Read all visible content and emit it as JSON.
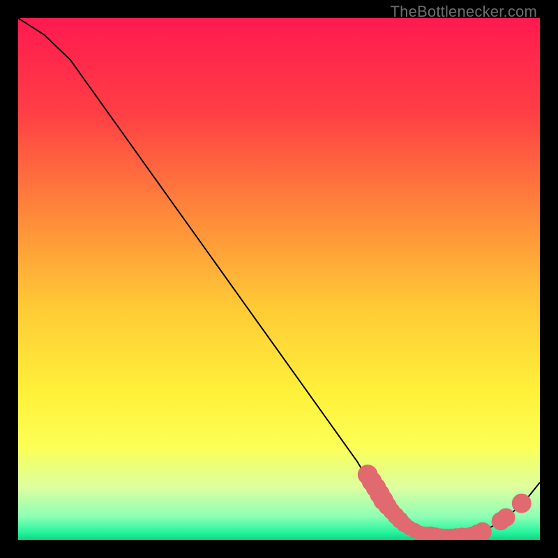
{
  "watermark": "TheBottlenecker.com",
  "chart_data": {
    "type": "line",
    "title": "",
    "xlabel": "",
    "ylabel": "",
    "xlim": [
      0,
      100
    ],
    "ylim": [
      0,
      100
    ],
    "curve": [
      {
        "x": 0.0,
        "y": 100.0
      },
      {
        "x": 5.0,
        "y": 96.8
      },
      {
        "x": 10.0,
        "y": 92.0
      },
      {
        "x": 15.0,
        "y": 85.0
      },
      {
        "x": 20.0,
        "y": 78.0
      },
      {
        "x": 25.0,
        "y": 71.0
      },
      {
        "x": 30.0,
        "y": 64.0
      },
      {
        "x": 35.0,
        "y": 57.0
      },
      {
        "x": 40.0,
        "y": 50.0
      },
      {
        "x": 45.0,
        "y": 43.0
      },
      {
        "x": 50.0,
        "y": 36.0
      },
      {
        "x": 55.0,
        "y": 29.0
      },
      {
        "x": 60.0,
        "y": 22.0
      },
      {
        "x": 65.0,
        "y": 15.0
      },
      {
        "x": 68.0,
        "y": 10.0
      },
      {
        "x": 71.0,
        "y": 6.0
      },
      {
        "x": 74.0,
        "y": 3.0
      },
      {
        "x": 77.0,
        "y": 1.2
      },
      {
        "x": 80.0,
        "y": 0.6
      },
      {
        "x": 83.0,
        "y": 0.5
      },
      {
        "x": 86.0,
        "y": 0.8
      },
      {
        "x": 89.0,
        "y": 1.6
      },
      {
        "x": 92.0,
        "y": 3.2
      },
      {
        "x": 95.0,
        "y": 5.5
      },
      {
        "x": 98.0,
        "y": 8.5
      },
      {
        "x": 100.0,
        "y": 11.0
      }
    ],
    "markers": [
      {
        "x": 67.0,
        "y": 12.5,
        "r": 3.5
      },
      {
        "x": 67.8,
        "y": 11.2,
        "r": 3.5
      },
      {
        "x": 68.6,
        "y": 10.0,
        "r": 3.5
      },
      {
        "x": 69.3,
        "y": 8.8,
        "r": 3.5
      },
      {
        "x": 70.0,
        "y": 7.6,
        "r": 3.5
      },
      {
        "x": 70.8,
        "y": 6.5,
        "r": 3.2
      },
      {
        "x": 71.6,
        "y": 5.5,
        "r": 3.0
      },
      {
        "x": 72.4,
        "y": 4.6,
        "r": 3.0
      },
      {
        "x": 73.2,
        "y": 3.8,
        "r": 3.0
      },
      {
        "x": 74.0,
        "y": 3.0,
        "r": 2.8
      },
      {
        "x": 75.0,
        "y": 2.3,
        "r": 2.6
      },
      {
        "x": 76.0,
        "y": 1.8,
        "r": 2.6
      },
      {
        "x": 77.0,
        "y": 1.3,
        "r": 2.6
      },
      {
        "x": 78.0,
        "y": 1.0,
        "r": 2.8
      },
      {
        "x": 79.0,
        "y": 0.8,
        "r": 3.2
      },
      {
        "x": 80.0,
        "y": 0.6,
        "r": 3.2
      },
      {
        "x": 81.0,
        "y": 0.55,
        "r": 3.0
      },
      {
        "x": 82.0,
        "y": 0.5,
        "r": 3.0
      },
      {
        "x": 83.0,
        "y": 0.5,
        "r": 3.0
      },
      {
        "x": 84.0,
        "y": 0.6,
        "r": 3.0
      },
      {
        "x": 85.0,
        "y": 0.7,
        "r": 3.0
      },
      {
        "x": 86.0,
        "y": 0.8,
        "r": 2.8
      },
      {
        "x": 87.0,
        "y": 1.0,
        "r": 2.8
      },
      {
        "x": 88.0,
        "y": 1.3,
        "r": 3.0
      },
      {
        "x": 89.0,
        "y": 1.6,
        "r": 3.2
      },
      {
        "x": 92.5,
        "y": 3.6,
        "r": 3.2
      },
      {
        "x": 93.5,
        "y": 4.3,
        "r": 3.2
      },
      {
        "x": 96.5,
        "y": 7.0,
        "r": 3.4
      }
    ],
    "gradient_stops": [
      {
        "offset": 0,
        "color": "#ff1a50"
      },
      {
        "offset": 0.18,
        "color": "#ff3e45"
      },
      {
        "offset": 0.38,
        "color": "#ff8a3a"
      },
      {
        "offset": 0.55,
        "color": "#ffc936"
      },
      {
        "offset": 0.72,
        "color": "#fff13a"
      },
      {
        "offset": 0.82,
        "color": "#fcff55"
      },
      {
        "offset": 0.9,
        "color": "#dcffa0"
      },
      {
        "offset": 0.955,
        "color": "#8dffb5"
      },
      {
        "offset": 0.985,
        "color": "#28f59d"
      },
      {
        "offset": 1.0,
        "color": "#11d486"
      }
    ],
    "marker_color": "#e06a6f",
    "line_color": "#000000"
  }
}
